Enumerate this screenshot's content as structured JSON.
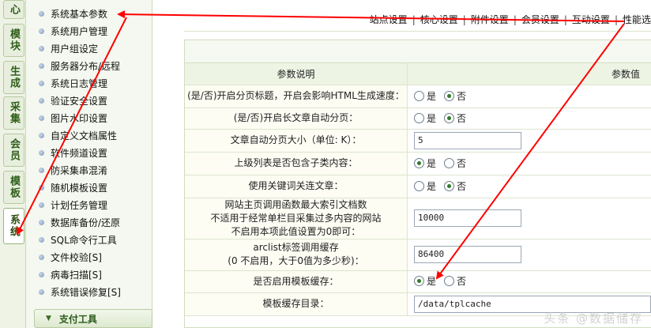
{
  "vtabs": [
    "心",
    "模块",
    "生成",
    "采集",
    "会员",
    "模板",
    "系统"
  ],
  "menu_items": [
    "系统基本参数",
    "系统用户管理",
    "用户组设定",
    "服务器分布/远程",
    "系统日志管理",
    "验证安全设置",
    "图片水印设置",
    "自定义文档属性",
    "软件频道设置",
    "防采集串混淆",
    "随机模板设置",
    "计划任务管理",
    "数据库备份/还原",
    "SQL命令行工具",
    "文件校验[S]",
    "病毒扫描[S]",
    "系统错误修复[S]"
  ],
  "menu_section": "支付工具",
  "topnav": [
    "站点设置",
    "核心设置",
    "附件设置",
    "会员设置",
    "互动设置",
    "性能选"
  ],
  "table": {
    "headers": [
      "参数说明",
      "参数值"
    ],
    "rows": [
      {
        "label": "(是/否)开启分页标题，开启会影响HTML生成速度：",
        "type": "radio",
        "selected": "否"
      },
      {
        "label": "(是/否)开启长文章自动分页：",
        "type": "radio",
        "selected": "否"
      },
      {
        "label": "文章自动分页大小（单位: K）：",
        "type": "text",
        "value": "5"
      },
      {
        "label": "上级列表是否包含子类内容：",
        "type": "radio",
        "selected": "是"
      },
      {
        "label": "使用关键词关连文章：",
        "type": "radio",
        "selected": "否"
      },
      {
        "label": "网站主页调用函数最大索引文档数\n不适用于经常单栏目采集过多内容的网站\n不启用本项此值设置为0即可：",
        "type": "text",
        "value": "10000"
      },
      {
        "label": "arclist标签调用缓存\n(0 不启用，大于0值为多少秒)：",
        "type": "text",
        "value": "86400"
      },
      {
        "label": "是否启用模板缓存：",
        "type": "radio",
        "selected": "是"
      },
      {
        "label": "模板缓存目录：",
        "type": "text",
        "value": "/data/tplcache"
      }
    ]
  },
  "radio_labels": {
    "yes": "是",
    "no": "否"
  },
  "watermark": "头条 @数据储存",
  "colors": {
    "accent": "#2f5e1a",
    "arrow": "#ff0000"
  }
}
